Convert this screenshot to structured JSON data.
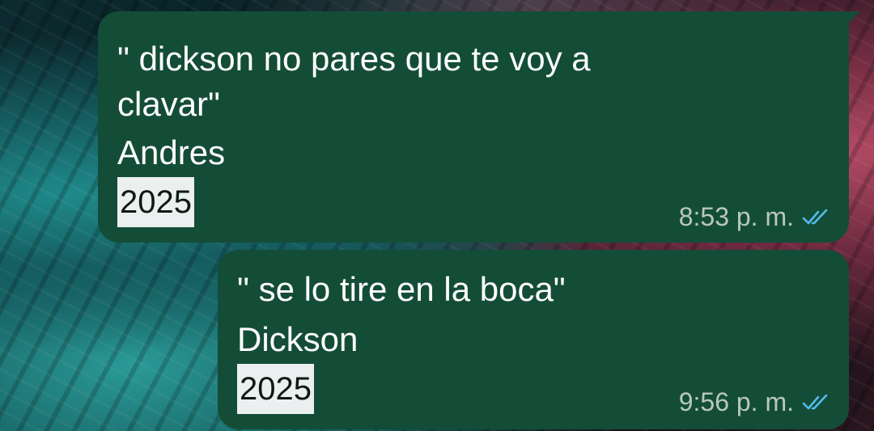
{
  "messages": [
    {
      "quote_line1": "\" dickson no pares que te voy a",
      "quote_line2": "clavar\"",
      "author": "Andres",
      "year": "2025",
      "time": "8:53 p. m.",
      "status_icon": "double-check-icon",
      "status_color": "#53bdeb"
    },
    {
      "quote_line1": "\" se lo tire en la boca\"",
      "author": "Dickson",
      "year": "2025",
      "time": "9:56 p. m.",
      "status_icon": "double-check-icon",
      "status_color": "#53bdeb"
    }
  ],
  "colors": {
    "bubble": "#144d37",
    "text": "#ffffff",
    "meta_text": "#b9c7c0",
    "highlight_bg": "#eceff0"
  }
}
